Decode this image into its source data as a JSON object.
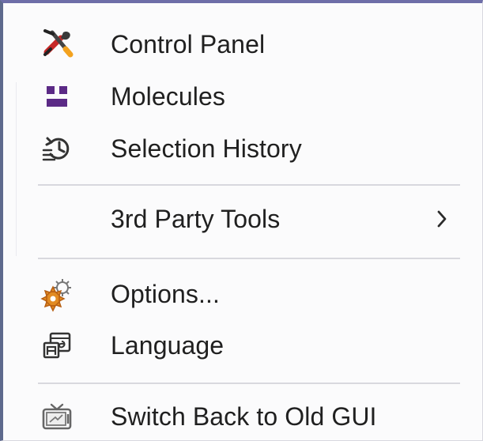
{
  "menu": {
    "items": [
      {
        "label": "Control Panel",
        "icon": "tools-icon"
      },
      {
        "label": "Molecules",
        "icon": "molecules-icon"
      },
      {
        "label": "Selection History",
        "icon": "history-icon"
      },
      {
        "label": "3rd Party Tools",
        "icon": "chevron-right-icon"
      },
      {
        "label": "Options...",
        "icon": "gear-icon"
      },
      {
        "label": "Language",
        "icon": "language-icon"
      },
      {
        "label": "Switch Back to Old GUI",
        "icon": "tv-icon"
      }
    ]
  },
  "colors": {
    "frame_top": "#6e6ea8",
    "frame_left": "#5e6a8d",
    "menu_background": "#fbfbfc",
    "separator": "#d8d8de",
    "text": "#202020",
    "molecules_purple": "#5b2a86",
    "gear_orange": "#e28b22",
    "tool_red": "#c62828"
  }
}
